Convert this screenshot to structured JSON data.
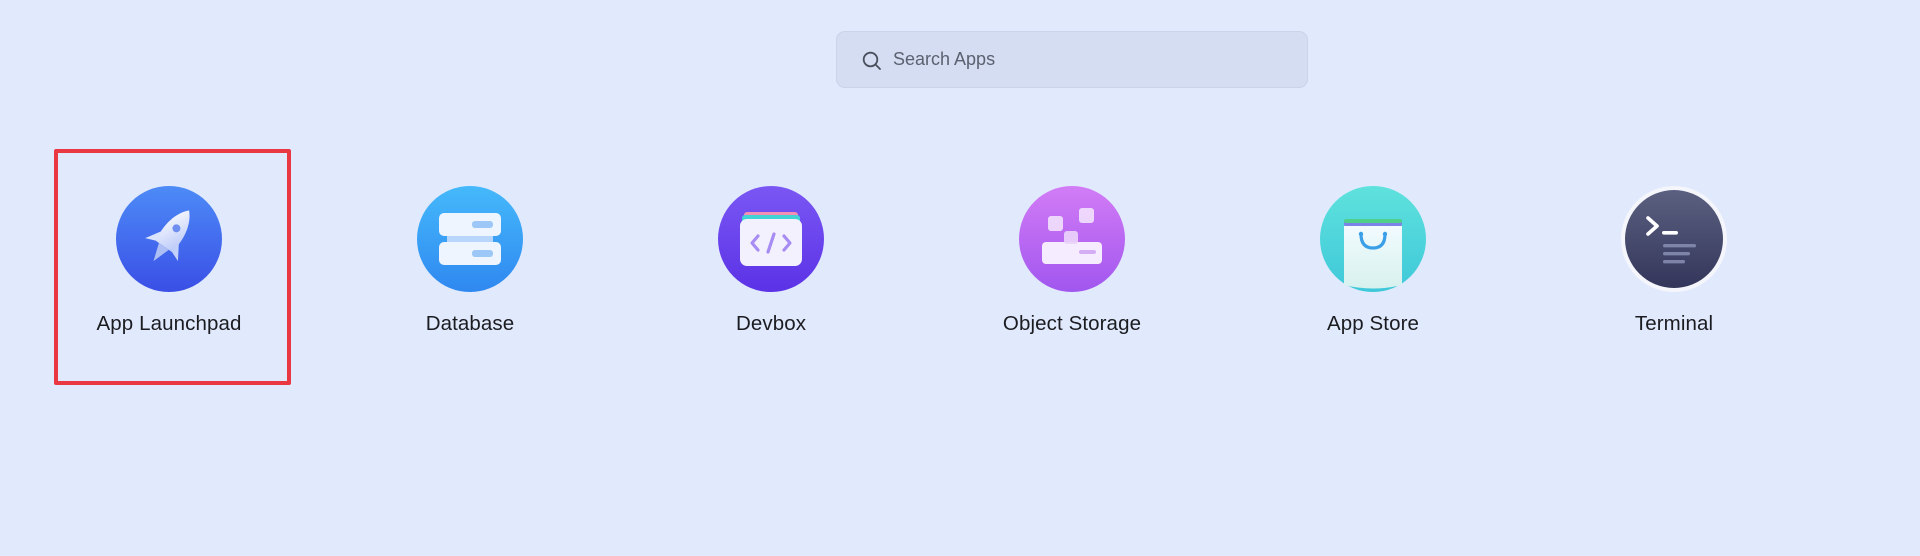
{
  "search": {
    "placeholder": "Search Apps",
    "value": ""
  },
  "apps": [
    {
      "label": "App Launchpad",
      "icon": "rocket-icon",
      "selected": true
    },
    {
      "label": "Database",
      "icon": "database-icon",
      "selected": false
    },
    {
      "label": "Devbox",
      "icon": "devbox-code-icon",
      "selected": false
    },
    {
      "label": "Object Storage",
      "icon": "object-storage-icon",
      "selected": false
    },
    {
      "label": "App Store",
      "icon": "shopping-bag-icon",
      "selected": false
    },
    {
      "label": "Terminal",
      "icon": "terminal-icon",
      "selected": false
    }
  ],
  "colors": {
    "background": "#e1e9fd",
    "selection_border": "#ea3843"
  }
}
